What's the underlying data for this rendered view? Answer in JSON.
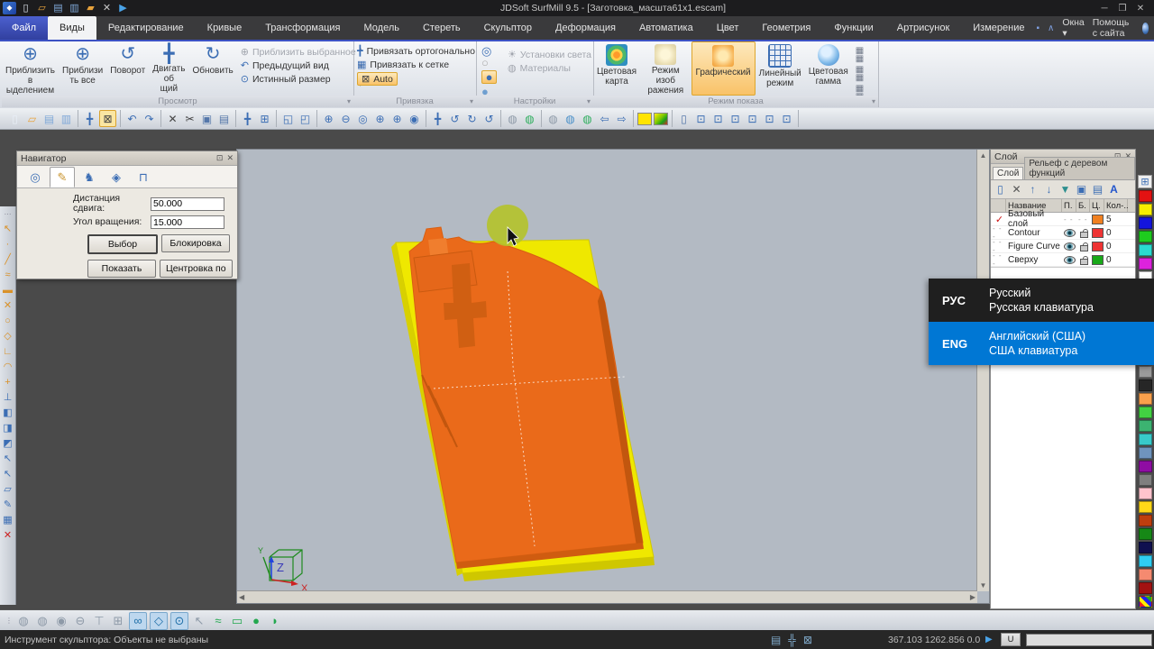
{
  "window": {
    "title": "JDSoft SurfMill 9.5 - [Заготовка_масшта61x1.escam]"
  },
  "quick_access": [
    "app-logo",
    "new-file",
    "open-file",
    "save",
    "save-as",
    "folder",
    "tools",
    "play"
  ],
  "menu": {
    "tabs": [
      "Файл",
      "Виды",
      "Редактирование",
      "Кривые",
      "Трансформация",
      "Модель",
      "Стереть",
      "Скульптор",
      "Деформация",
      "Автоматика",
      "Цвет",
      "Геометрия",
      "Функции",
      "Артрисунок",
      "Измерение"
    ],
    "active": "Виды",
    "windows_label": "Окна",
    "help_label": "Помощь с сайта"
  },
  "ribbon": {
    "view": {
      "label": "Просмотр",
      "big": [
        "Приблизить в\nыделением",
        "Приблизи\nть все",
        "Поворот",
        "Двигать об\nщий план",
        "Обновить"
      ],
      "small": [
        "Приблизить выбранное",
        "Предыдущий вид",
        "Истинный размер"
      ]
    },
    "snap": {
      "label": "Привязка",
      "items": [
        "Привязать ортогонально",
        "Привязать к сетке",
        "Auto"
      ]
    },
    "settings": {
      "label": "Настройки",
      "items": [
        "Установки света",
        "Материалы"
      ]
    },
    "display": {
      "label": "Режим показа",
      "big": [
        "Цветовая\nкарта",
        "Режим изоб\nражения",
        "Графический",
        "Линейный\nрежим",
        "Цветовая\nгамма"
      ]
    }
  },
  "main_toolbar": {
    "groups": [
      [
        "new-file",
        "open-file",
        "save",
        "save-as"
      ],
      [
        "pan",
        "no-snap"
      ],
      [
        "undo",
        "redo"
      ],
      [
        "delete",
        "cut",
        "copy",
        "paste"
      ],
      [
        "move",
        "view-cube"
      ],
      [
        "window-in",
        "window-out"
      ],
      [
        "zoom-window",
        "zoom-out",
        "zoom-dynamic",
        "zoom-select",
        "zoom-all",
        "zoom-true"
      ],
      [
        "pan-view",
        "rotate-x",
        "rotate-y",
        "rotate-z"
      ],
      [
        "lamp-off",
        "lamp-on"
      ],
      [
        "material-1",
        "material-2",
        "material-3",
        "prev-view",
        "next-view"
      ],
      [
        "fill-color",
        "gradient"
      ],
      [
        "clip-plane",
        "view-iso",
        "view-front",
        "view-back",
        "view-left",
        "view-right",
        "view-top"
      ]
    ],
    "highlighted": [
      "no-snap"
    ]
  },
  "left_toolbar": [
    "select",
    "point",
    "line",
    "spline",
    "dash",
    "erase",
    "circle",
    "polygon",
    "perpendicular",
    "arc",
    "node",
    "axis",
    "surface-1",
    "surface-2",
    "surface-3",
    "pick",
    "pick-delete",
    "plane",
    "sculpt-check",
    "region",
    "delete-red"
  ],
  "bottom_toolbar": [
    "smooth-1",
    "smooth-2",
    "sphere",
    "disc",
    "pin",
    "stamp-window",
    "link-circles",
    "lasso",
    "rings",
    "arrow",
    "curve",
    "frame",
    "ellipse",
    "shell"
  ],
  "navigator": {
    "title": "Навигатор",
    "tabs": [
      "target",
      "pen",
      "horse",
      "cube",
      "stamp"
    ],
    "active_tab": "pen",
    "fields": [
      {
        "label": "Дистанция\nсдвига:",
        "value": "50.000"
      },
      {
        "label": "Угол вращения:",
        "value": "15.000"
      }
    ],
    "buttons": [
      "Выбор",
      "Блокировка",
      "Показать",
      "Центровка по"
    ]
  },
  "layers": {
    "title": "Слой",
    "tabs": [
      "Слой",
      "Рельеф с деревом функций"
    ],
    "toolbar": [
      "new-layer",
      "delete-layer",
      "move-up",
      "move-down",
      "filter",
      "import",
      "copy-layer",
      "text-style"
    ],
    "columns": [
      "Название",
      "П.",
      "Б.",
      "Ц.",
      "Кол-.."
    ],
    "rows": [
      {
        "name": "Базовый слой",
        "current": true,
        "visible": false,
        "unlocked": false,
        "color": "#f08020",
        "count": "5"
      },
      {
        "name": "Contour",
        "current": false,
        "visible": true,
        "unlocked": true,
        "color": "#ee3333",
        "count": "0"
      },
      {
        "name": "Figure Curve",
        "current": false,
        "visible": true,
        "unlocked": true,
        "color": "#ee3333",
        "count": "0"
      },
      {
        "name": "Сверху",
        "current": false,
        "visible": true,
        "unlocked": true,
        "color": "#18a818",
        "count": "0"
      }
    ]
  },
  "palette": {
    "colors": [
      "#e31212",
      "#f7ee00",
      "#1414dd",
      "#1ecb1e",
      "#2adbd0",
      "#dd22dd",
      "#ffffff",
      "#8b4513",
      "#7f7f1a",
      "#0f6e0f",
      "#0f7f7f",
      "#0f0f7f",
      "#7f0f7f",
      "#9a9a9a",
      "#262626",
      "#f9a04c",
      "#42d142",
      "#3cb371",
      "#38caca",
      "#6f94bd",
      "#8f0da3",
      "#7f7f7f",
      "#ffc3cd",
      "#ffd818",
      "#bf3e0e",
      "#168816",
      "#10104f",
      "#2fcdf2",
      "#f58a70",
      "#a31212"
    ]
  },
  "language_popup": {
    "options": [
      {
        "code": "РУС",
        "name": "Русский",
        "keyboard": "Русская клавиатура",
        "selected": false
      },
      {
        "code": "ENG",
        "name": "Английский (США)",
        "keyboard": "США клавиатура",
        "selected": true
      }
    ]
  },
  "viewport": {
    "axis": {
      "x": "X",
      "y": "Y",
      "z": "Z"
    }
  },
  "statusbar": {
    "tool_text": "Инструмент скульптора: Объекты не выбраны",
    "coordinates": "367.103 1262.856 0.0",
    "u_label": "U"
  },
  "colors": {
    "accent_orange": "#f9c268",
    "selection_blue": "#0077d4",
    "relief_orange": "#ea6a1a",
    "stock_yellow": "#efe800",
    "viewport_bg": "#b3bac3"
  }
}
